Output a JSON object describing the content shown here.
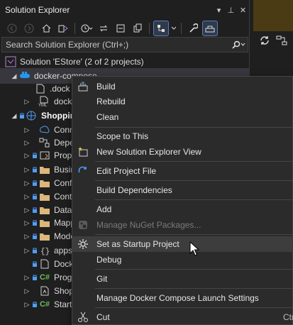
{
  "panel": {
    "title": "Solution Explorer",
    "title_buttons": [
      "▾",
      "⊥",
      "✕"
    ]
  },
  "search": {
    "placeholder": "Search Solution Explorer (Ctrl+;)"
  },
  "tree": {
    "solution": "Solution 'EStore' (2 of 2 projects)",
    "items": [
      {
        "label": "docker-compose"
      },
      {
        "label": ".dock"
      },
      {
        "label": "dock"
      },
      {
        "label": "Shoppin"
      },
      {
        "label": "Conn"
      },
      {
        "label": "Depe"
      },
      {
        "label": "Prope"
      },
      {
        "label": "Busin"
      },
      {
        "label": "Confi"
      },
      {
        "label": "Cont"
      },
      {
        "label": "DataA"
      },
      {
        "label": "Mapp"
      },
      {
        "label": "Mode"
      },
      {
        "label": "appse"
      },
      {
        "label": "Dock"
      },
      {
        "label": "Progr"
      },
      {
        "label": "Shop"
      },
      {
        "label": "Startu"
      }
    ],
    "yml_badge": "YML",
    "cs_badge": "C#"
  },
  "menu": {
    "items": [
      {
        "label": "Build",
        "icon": "build-icon"
      },
      {
        "label": "Rebuild",
        "icon": ""
      },
      {
        "label": "Clean",
        "icon": ""
      },
      {
        "label": "Scope to This",
        "icon": ""
      },
      {
        "label": "New Solution Explorer View",
        "icon": "new-view-icon"
      },
      {
        "label": "Edit Project File",
        "icon": "refresh-arrow-icon"
      },
      {
        "label": "Build Dependencies",
        "icon": ""
      },
      {
        "label": "Add",
        "icon": ""
      },
      {
        "label": "Manage NuGet Packages...",
        "icon": "nuget-icon"
      },
      {
        "label": "Set as Startup Project",
        "icon": "gear-icon"
      },
      {
        "label": "Debug",
        "icon": ""
      },
      {
        "label": "Git",
        "icon": ""
      },
      {
        "label": "Manage Docker Compose Launch Settings",
        "icon": ""
      },
      {
        "label": "Cut",
        "icon": "scissors-icon",
        "shortcut": "Ctr"
      }
    ]
  },
  "colors": {
    "accent_blue": "#5a7cc0",
    "git_lock": "#4e9df7",
    "highlight": "#3d3d3d",
    "cs_green": "#6cbf5a"
  }
}
